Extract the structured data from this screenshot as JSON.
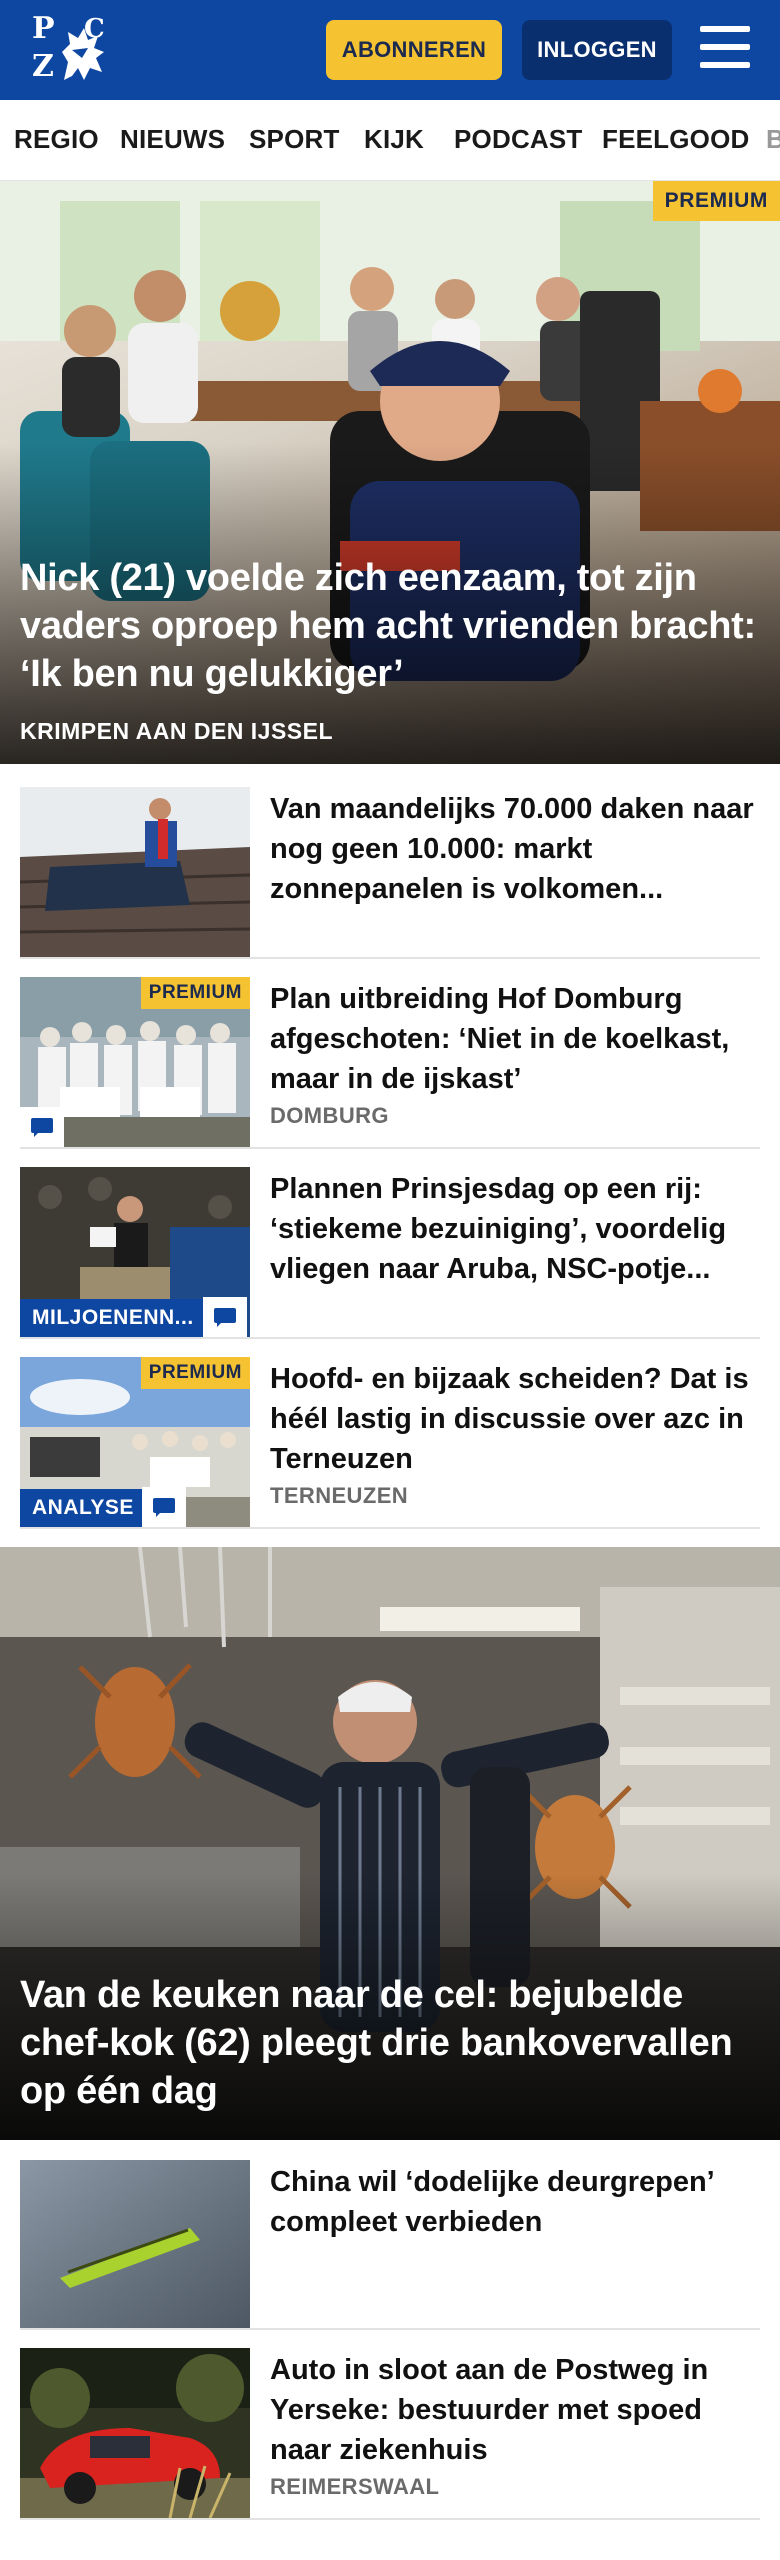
{
  "header": {
    "logo_letters": [
      "P",
      "Z",
      "C"
    ],
    "subscribe_label": "ABONNEREN",
    "login_label": "INLOGGEN",
    "menu_icon": "hamburger-menu-icon",
    "colors": {
      "brand_blue": "#0e47a1",
      "subscribe_yellow": "#f5c232",
      "login_dark": "#0a2f6e"
    }
  },
  "nav": {
    "items": [
      "REGIO",
      "NIEUWS",
      "SPORT",
      "KIJK",
      "PODCAST",
      "FEELGOOD",
      "B"
    ]
  },
  "hero1": {
    "badge": "PREMIUM",
    "title": "Nick (21) voelde zich eenzaam, tot zijn vaders oproep hem acht vrienden bracht: ‘Ik ben nu gelukkiger’",
    "kicker": "KRIMPEN AAN DEN IJSSEL"
  },
  "articles": [
    {
      "title": "Van maandelijks 70.000 daken naar nog geen 10.000: markt zonnepanelen is volkomen...",
      "location": "",
      "premium": "",
      "tag": "",
      "has_comments": false
    },
    {
      "title": "Plan uitbreiding Hof Domburg afgeschoten: ‘Niet in de koelkast, maar in de ijskast’",
      "location": "DOMBURG",
      "premium": "PREMIUM",
      "tag": "",
      "has_comments": true
    },
    {
      "title": "Plannen Prinsjesdag op een rij: ‘stiekeme bezuiniging’, voordelig vliegen naar Aruba, NSC-potje...",
      "location": "",
      "premium": "",
      "tag": "MILJOENENN...",
      "has_comments": true
    },
    {
      "title": "Hoofd- en bijzaak scheiden? Dat is héél lastig in discussie over azc in Terneuzen",
      "location": "TERNEUZEN",
      "premium": "PREMIUM",
      "tag": "ANALYSE",
      "has_comments": true
    }
  ],
  "hero2": {
    "title": "Van de keuken naar de cel: bejubelde chef-kok (62) pleegt drie bankoverval­len op één dag"
  },
  "articles2": [
    {
      "title": "China wil ‘dodelijke deurgrepen’ compleet verbieden",
      "location": ""
    },
    {
      "title": "Auto in sloot aan de Postweg in Yerseke: bestuurder met spoed naar ziekenhuis",
      "location": "REIMERSWAAL"
    }
  ]
}
